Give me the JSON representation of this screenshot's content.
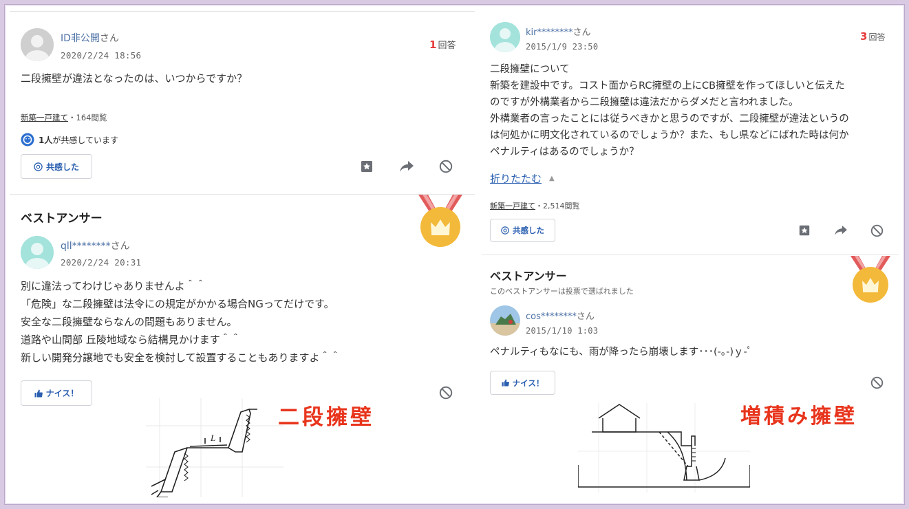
{
  "left": {
    "question": {
      "user": "ID非公開",
      "san": "さん",
      "date": "2020/2/24 18:56",
      "answer_count": "1",
      "answer_label": "回答",
      "text": [
        "二段擁壁が違法となったのは、いつからですか？"
      ],
      "category": "新築一戸建て",
      "views": "・164閲覧",
      "empathy_count": "1人",
      "empathy_text": "が共感しています",
      "empathy_button": "共感した"
    },
    "best": {
      "heading": "ベストアンサー",
      "user": "qll********",
      "san": "さん",
      "date": "2020/2/24 20:31",
      "text": [
        "別に違法ってわけじゃありませんよ＾＾",
        "「危険」な二段擁壁は法令にの規定がかかる場合NGってだけです。",
        "安全な二段擁壁ならなんの問題もありません。",
        "道路や山間部 丘陵地域なら結構見かけます＾＾",
        "新しい開発分譲地でも安全を検討して設置することもありますよ＾＾"
      ],
      "nice_button": "ナイス！"
    },
    "overlay_label": "二段擁壁",
    "sketch_label": "L"
  },
  "right": {
    "question": {
      "user": "kir********",
      "san": "さん",
      "date": "2015/1/9 23:50",
      "answer_count": "3",
      "answer_label": "回答",
      "text": [
        "二段擁壁について",
        "新築を建設中です。コスト面からRC擁壁の上にCB擁壁を作ってほしいと伝えた",
        "のですが外構業者から二段擁壁は違法だからダメだと言われました。",
        "外構業者の言ったことには従うべきかと思うのですが、二段擁壁が違法というの",
        "は何処かに明文化されているのでしょうか？また、もし県などにばれた時は何か",
        "ペナルティはあるのでしょうか？"
      ],
      "fold": "折りたたむ",
      "category": "新築一戸建て",
      "views": "・2,514閲覧",
      "empathy_button": "共感した"
    },
    "best": {
      "heading": "ベストアンサー",
      "sub": "このベストアンサーは投票で選ばれました",
      "user": "cos********",
      "san": "さん",
      "date": "2015/1/10 1:03",
      "text": [
        "ペナルティもなにも、雨が降ったら崩壊します･･･(-｡-)ｙ-ﾟ"
      ],
      "nice_button": "ナイス！"
    },
    "overlay_label": "増積み擁壁"
  },
  "colors": {
    "accent_red": "#e8341c",
    "link_blue": "#2a5fb0",
    "medal_gold": "#f3b93a",
    "ribbon": "#e25b5b",
    "frame": "#d9c9e3"
  },
  "icons": [
    "bookmark-icon",
    "share-icon",
    "block-icon",
    "empathy-icon",
    "thumbs-up-icon",
    "crown-medal-icon",
    "avatar-icon"
  ]
}
